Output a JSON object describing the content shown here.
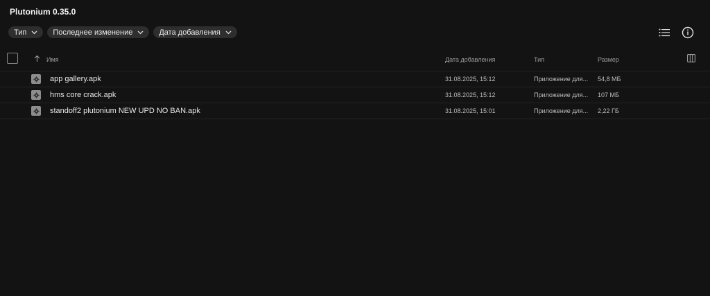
{
  "app": {
    "title": "Plutonium 0.35.0"
  },
  "filters": [
    {
      "label": "Тип"
    },
    {
      "label": "Последнее изменение"
    },
    {
      "label": "Дата добавления"
    }
  ],
  "toolbar": {
    "view_icon": "list-view-icon",
    "info_icon": "info-icon"
  },
  "table": {
    "columns": {
      "name": "Имя",
      "date_added": "Дата добавления",
      "type": "Тип",
      "size": "Размер"
    },
    "sort": {
      "column": "name",
      "direction": "ascending"
    },
    "rows": [
      {
        "icon": "settings-file-icon",
        "name": "app gallery.apk",
        "date_added": "31.08.2025, 15:12",
        "type": "Приложение для...",
        "size": "54,8 МБ"
      },
      {
        "icon": "settings-file-icon",
        "name": "hms core crack.apk",
        "date_added": "31.08.2025, 15:12",
        "type": "Приложение для...",
        "size": "107 МБ"
      },
      {
        "icon": "settings-file-icon",
        "name": "standoff2 plutonium NEW UPD NO BAN.apk",
        "date_added": "31.08.2025, 15:01",
        "type": "Приложение для...",
        "size": "2,22 ГБ"
      }
    ]
  }
}
